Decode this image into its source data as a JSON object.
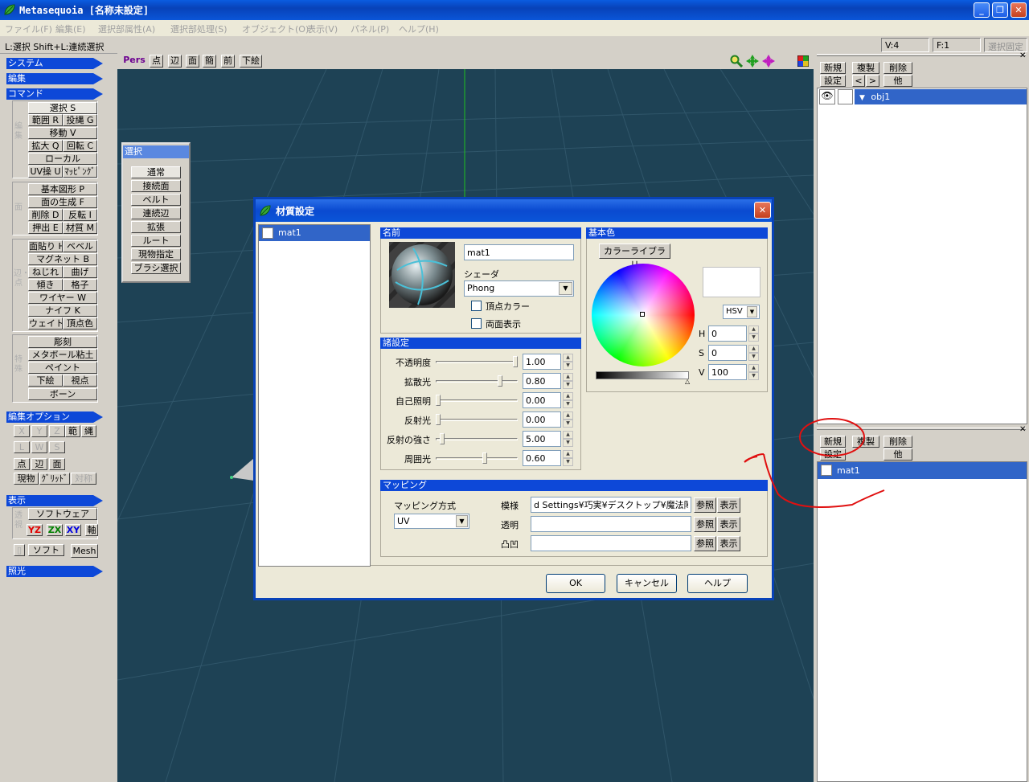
{
  "app": {
    "title": "Metasequoia [名称未設定]"
  },
  "menu": [
    "ファイル(F)",
    "編集(E)",
    "選択部属性(A)",
    "選択部処理(S)",
    "オブジェクト(O)",
    "表示(V)",
    "パネル(P)",
    "ヘルプ(H)"
  ],
  "status": {
    "hint": "L:選択  Shift+L:連続選択",
    "vertices": "V:4",
    "faces": "F:1",
    "lock": "選択固定"
  },
  "left_panel": {
    "system": "システム",
    "edit": "編集",
    "command": "コマンド",
    "group_labels": {
      "edit": "編集",
      "face": "面",
      "edge": "辺・点",
      "special": "特殊"
    },
    "cmd_edit": [
      "選択 S",
      "範囲 R",
      "投縄 G",
      "移動 V",
      "拡大 Q",
      "回転 C",
      "ローカル",
      "UV操 U",
      "ﾏｯﾋﾟﾝｸﾞ"
    ],
    "cmd_face": [
      "基本図形 P",
      "面の生成 F",
      "削除 D",
      "反転 I",
      "押出 E",
      "材質 M"
    ],
    "cmd_edge": [
      "面貼り H",
      "ベベル",
      "マグネット B",
      "ねじれ",
      "曲げ",
      "傾き",
      "格子",
      "ワイヤー W",
      "ナイフ K",
      "ウェイト",
      "頂点色"
    ],
    "cmd_special": [
      "彫刻",
      "メタボール粘土",
      "ペイント",
      "下絵",
      "視点",
      "ボーン"
    ],
    "edit_options": "編集オプション",
    "opt_axes": [
      "X",
      "Y",
      "Z",
      "範",
      "縄"
    ],
    "opt_lws": [
      "L",
      "W",
      "S"
    ],
    "opt_elem": [
      "点",
      "辺",
      "面"
    ],
    "opt_misc": [
      "現物",
      "ｸﾞﾘｯﾄﾞ",
      "対称"
    ],
    "display": "表示",
    "display_group": "透視",
    "render": "ソフトウェア",
    "planes": [
      "YZ",
      "ZX",
      "XY",
      "軸"
    ],
    "shade": [
      "ソフト",
      "Mesh"
    ],
    "lighting": "照光"
  },
  "viewbar": {
    "pers": "Pers",
    "buttons": [
      "点",
      "辺",
      "面",
      "簡",
      "前",
      "下絵"
    ]
  },
  "select_panel": {
    "title": "選択",
    "items": [
      "通常",
      "接続面",
      "ベルト",
      "連続辺",
      "拡張",
      "ルート",
      "現物指定",
      "ブラシ選択"
    ]
  },
  "object_panel": {
    "buttons": [
      "新規",
      "複製",
      "削除",
      "設定",
      "<",
      ">",
      "他"
    ],
    "objects": [
      "obj1"
    ]
  },
  "material_panel": {
    "buttons": [
      "新規",
      "複製",
      "削除",
      "設定",
      "他"
    ],
    "materials": [
      "mat1"
    ]
  },
  "dialog": {
    "title": "材質設定",
    "list": [
      "mat1"
    ],
    "name_header": "名前",
    "name_value": "mat1",
    "shader_label": "シェーダ",
    "shader_value": "Phong",
    "vertex_color": "頂点カラー",
    "double_sided": "両面表示",
    "params_header": "諸設定",
    "params": [
      {
        "label": "不透明度",
        "value": "1.00",
        "level": 1.0
      },
      {
        "label": "拡散光",
        "value": "0.80",
        "level": 0.8
      },
      {
        "label": "自己照明",
        "value": "0.00",
        "level": 0.0
      },
      {
        "label": "反射光",
        "value": "0.00",
        "level": 0.0
      },
      {
        "label": "反射の強さ",
        "value": "5.00",
        "level": 0.05
      },
      {
        "label": "周囲光",
        "value": "0.60",
        "level": 0.6
      }
    ],
    "color_header": "基本色",
    "color_library": "カラーライブラリ",
    "color_mode": "HSV",
    "h": "0",
    "s": "0",
    "v": "100",
    "h_label": "H",
    "s_label": "S",
    "v_label": "V",
    "mapping_header": "マッピング",
    "mapping_method_label": "マッピング方式",
    "mapping_method": "UV",
    "tex_label": "模様",
    "tex_value": "d Settings¥巧実¥デスクトップ¥魔法陣.jpg",
    "alpha_label": "透明",
    "bump_label": "凸凹",
    "browse": "参照",
    "show": "表示",
    "ok": "OK",
    "cancel": "キャンセル",
    "help": "ヘルプ"
  },
  "colors": {
    "accent": "#0d48d8",
    "viewport": "#1e4255",
    "annotation": "#e01010"
  }
}
